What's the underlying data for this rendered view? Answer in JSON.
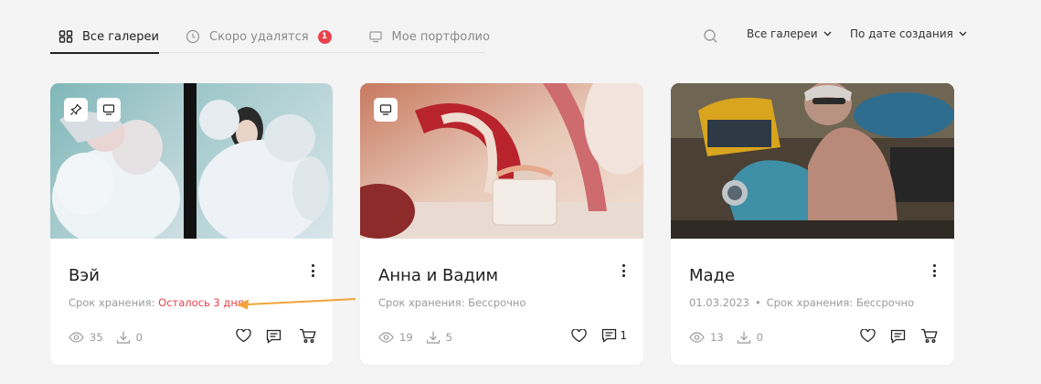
{
  "tabs": [
    {
      "label": "Все галереи",
      "icon": "grid-icon",
      "active": true
    },
    {
      "label": "Скоро удалятся",
      "icon": "clock-icon",
      "badge": "1"
    },
    {
      "label": "Мое портфолио",
      "icon": "monitor-icon"
    }
  ],
  "filters": {
    "gallery_select": "Все галереи",
    "sort_select": "По дате создания"
  },
  "cards": [
    {
      "title": "Вэй",
      "storage_label": "Срок хранения:",
      "storage_value": "Осталось 3 дня",
      "date": "",
      "views": "35",
      "downloads": "0",
      "comments": "",
      "pinned": true,
      "portfolio": true
    },
    {
      "title": "Анна и Вадим",
      "storage_label": "Срок хранения:",
      "storage_value": "Бессрочно",
      "date": "",
      "views": "19",
      "downloads": "5",
      "comments": "1",
      "pinned": false,
      "portfolio": true
    },
    {
      "title": "Маде",
      "storage_label": "Срок хранения:",
      "storage_value": "Бессрочно",
      "date": "01.03.2023",
      "date_sep": "•",
      "views": "13",
      "downloads": "0",
      "comments": "",
      "pinned": false,
      "portfolio": false
    }
  ],
  "colors": {
    "accent_red": "#e8434c",
    "annotation_arrow": "#f0a43a"
  }
}
